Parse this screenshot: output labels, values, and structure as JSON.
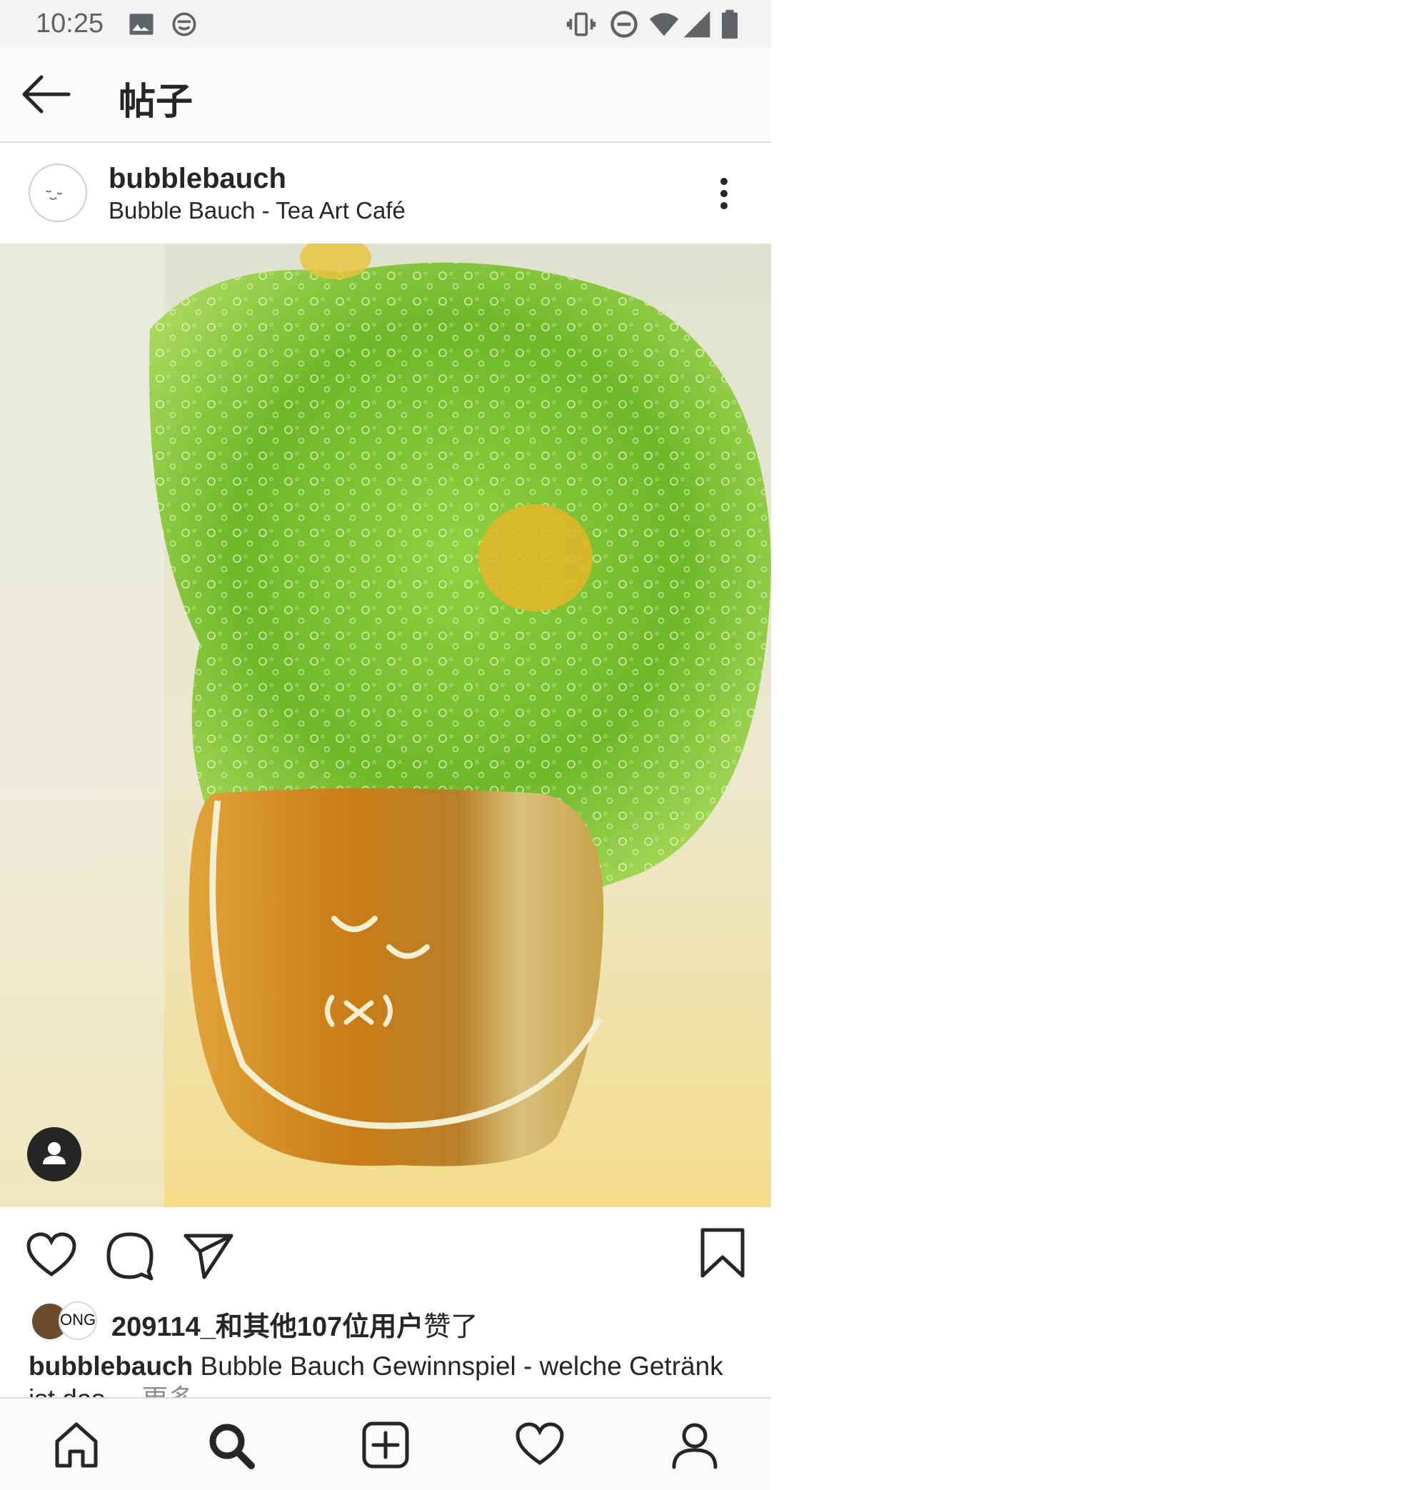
{
  "status_bar": {
    "time": "10:25",
    "left_icons": [
      "image-icon",
      "smiley-face-icon"
    ],
    "right_icons": [
      "vibrate-icon",
      "do-not-disturb-icon",
      "wifi-icon",
      "signal-icon",
      "battery-icon"
    ]
  },
  "app_bar": {
    "title": "帖子"
  },
  "post": {
    "username": "bubblebauch",
    "location": "Bubble Bauch - Tea Art Café",
    "likes_text": "209114_和其他107位用户",
    "likes_suffix": "赞了",
    "caption_user": "bubblebauch",
    "caption_text": " Bubble Bauch Gewinnspiel - welche Getränk ist das ... ",
    "caption_more": "更多",
    "liker_badge_text": "ONG"
  },
  "colors": {
    "text": "#262626",
    "muted": "#8e8e8e",
    "divider": "#dbdbdb",
    "bar_bg": "#fafafa"
  }
}
